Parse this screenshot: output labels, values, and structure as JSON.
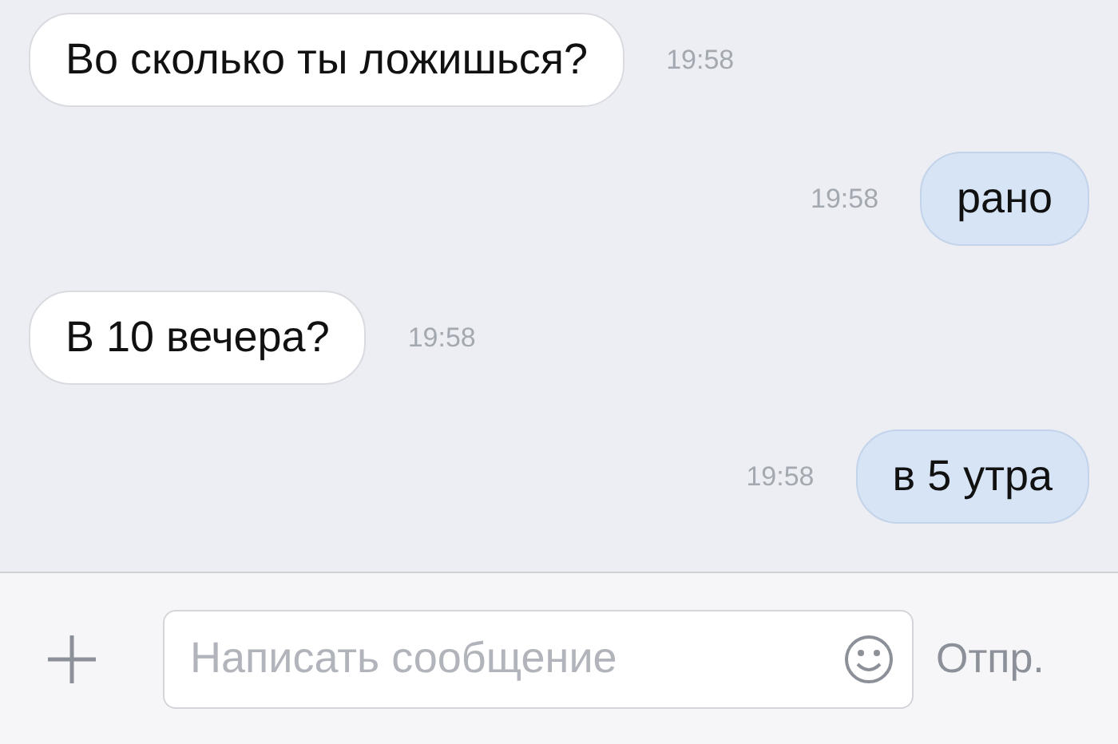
{
  "messages": [
    {
      "kind": "incoming",
      "text": "Во сколько ты ложишься?",
      "time": "19:58"
    },
    {
      "kind": "outgoing",
      "text": "рано",
      "time": "19:58"
    },
    {
      "kind": "incoming",
      "text": "В 10 вечера?",
      "time": "19:58"
    },
    {
      "kind": "outgoing",
      "text": "в 5 утра",
      "time": "19:58"
    }
  ],
  "composer": {
    "placeholder": "Написать сообщение",
    "send": "Отпр."
  }
}
